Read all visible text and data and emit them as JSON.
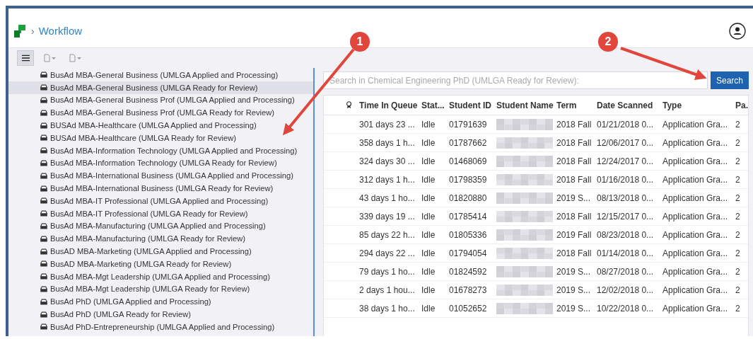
{
  "breadcrumb": {
    "separator": "›",
    "title": "Workflow"
  },
  "toolbar": [
    {
      "kind": "menu",
      "selected": true
    },
    {
      "kind": "doc"
    },
    {
      "kind": "doc"
    }
  ],
  "queues": [
    {
      "label": "BusAd MBA-General Business (UMLGA Applied and Processing)",
      "selected": false
    },
    {
      "label": "BusAd MBA-General Business (UMLGA Ready for Review)",
      "selected": true
    },
    {
      "label": "BusAd MBA-General Business Prof (UMLGA Applied and Processing)",
      "selected": false
    },
    {
      "label": "BusAd MBA-General Business Prof (UMLGA Ready for Review)",
      "selected": false
    },
    {
      "label": "BUSAd MBA-Healthcare (UMLGA Applied and Processing)",
      "selected": false
    },
    {
      "label": "BUSAd MBA-Healthcare (UMLGA Ready for Review)",
      "selected": false
    },
    {
      "label": "BusAd MBA-Information Technology (UMLGA Applied and Processing)",
      "selected": false
    },
    {
      "label": "BusAd MBA-Information Technology (UMLGA Ready for Review)",
      "selected": false
    },
    {
      "label": "BusAd MBA-International Business (UMLGA Applied and Processing)",
      "selected": false
    },
    {
      "label": "BusAd MBA-International Business (UMLGA Ready for Review)",
      "selected": false
    },
    {
      "label": "BusAd MBA-IT Professional (UMLGA Applied and Processing)",
      "selected": false
    },
    {
      "label": "BusAd MBA-IT Professional (UMLGA Ready for Review)",
      "selected": false
    },
    {
      "label": "BusAd MBA-Manufacturing (UMLGA Applied and Processing)",
      "selected": false
    },
    {
      "label": "BusAd MBA-Manufacturing (UMLGA Ready for Review)",
      "selected": false
    },
    {
      "label": "BusAD MBA-Marketing (UMLGA Applied and Processing)",
      "selected": false
    },
    {
      "label": "BusAD MBA-Marketing (UMLGA Ready for Review)",
      "selected": false
    },
    {
      "label": "BusAd MBA-Mgt Leadership (UMLGA Applied and Processing)",
      "selected": false
    },
    {
      "label": "BusAd MBA-Mgt Leadership (UMLGA Ready for Review)",
      "selected": false
    },
    {
      "label": "BusAd PhD (UMLGA Applied and Processing)",
      "selected": false
    },
    {
      "label": "BusAd PhD (UMLGA Ready for Review)",
      "selected": false
    },
    {
      "label": "BusAd PhD-Entrepreneurship (UMLGA Applied and Processing)",
      "selected": false
    }
  ],
  "search": {
    "placeholder": "Search in Chemical Engineering PhD (UMLGA Ready for Review):",
    "button": "Search"
  },
  "table": {
    "columns": [
      "Time In Queue",
      "Stat...",
      "Student ID",
      "Student Name",
      "Term",
      "Date Scanned",
      "Type",
      "Pa."
    ],
    "rows": [
      [
        "301 days 23 ...",
        "Idle",
        "01791639",
        "",
        "2018 Fall",
        "01/21/2018 0...",
        "Application Gra...",
        "2"
      ],
      [
        "358 days 1 h...",
        "Idle",
        "01787662",
        "",
        "2018 Fall",
        "12/06/2017 0...",
        "Application Gra...",
        "2"
      ],
      [
        "324 days 30 ...",
        "Idle",
        "01468069",
        "",
        "2018 Fall",
        "12/24/2017 0...",
        "Application Gra...",
        "2"
      ],
      [
        "312 days 1 h...",
        "Idle",
        "01798359",
        "",
        "2018 Fall",
        "01/16/2018 0...",
        "Application Gra...",
        "2"
      ],
      [
        "43 days 1 ho...",
        "Idle",
        "01820880",
        "",
        "2019 S...",
        "08/13/2018 0...",
        "Application Gra...",
        "2"
      ],
      [
        "339 days 19 ...",
        "Idle",
        "01785414",
        "",
        "2018 Fall",
        "12/15/2017 0...",
        "Application Gra...",
        "2"
      ],
      [
        "85 days 22 h...",
        "Idle",
        "01805336",
        "",
        "2019 Fall",
        "08/23/2018 0...",
        "Application Gra...",
        "2"
      ],
      [
        "294 days 22 ...",
        "Idle",
        "01794054",
        "",
        "2018 Fall",
        "01/14/2018 0...",
        "Application Gra...",
        "2"
      ],
      [
        "79 days 1 ho...",
        "Idle",
        "01824592",
        "",
        "2019 S...",
        "08/27/2018 0...",
        "Application Gra...",
        "2"
      ],
      [
        "2 days 1 hou...",
        "Idle",
        "01678273",
        "",
        "2019 S...",
        "12/02/2018 0...",
        "Application Gra...",
        "2"
      ],
      [
        "38 days 1 ho...",
        "Idle",
        "01052652",
        "",
        "2019 S...",
        "10/22/2018 0...",
        "Application Gra...",
        "2"
      ]
    ]
  },
  "callouts": [
    {
      "number": "1"
    },
    {
      "number": "2"
    }
  ]
}
